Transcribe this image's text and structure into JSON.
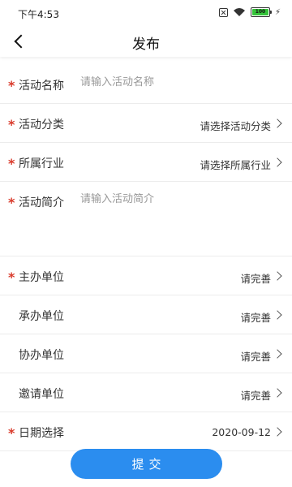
{
  "status_bar": {
    "time": "下午4:53",
    "battery": "100",
    "icons": [
      "sim-x-icon",
      "wifi-icon",
      "battery-icon",
      "charging-icon"
    ]
  },
  "header": {
    "title": "发布",
    "back_icon": "back-arrow-icon"
  },
  "form": {
    "activity_name": {
      "label": "活动名称",
      "placeholder": "请输入活动名称",
      "required": true
    },
    "activity_category": {
      "label": "活动分类",
      "value": "请选择活动分类",
      "required": true
    },
    "industry": {
      "label": "所属行业",
      "value": "请选择所属行业",
      "required": true
    },
    "activity_intro": {
      "label": "活动简介",
      "placeholder": "请输入活动简介",
      "required": true
    },
    "host_unit": {
      "label": "主办单位",
      "value": "请完善",
      "required": true
    },
    "organizer_unit": {
      "label": "承办单位",
      "value": "请完善",
      "required": false
    },
    "co_organizer_unit": {
      "label": "协办单位",
      "value": "请完善",
      "required": false
    },
    "invited_unit": {
      "label": "邀请单位",
      "value": "请完善",
      "required": false
    },
    "date": {
      "label": "日期选择",
      "value": "2020-09-12",
      "required": true
    }
  },
  "required_mark": "*",
  "submit_label": "提交",
  "colors": {
    "accent": "#2b8def",
    "required": "#d93a2b",
    "battery": "#35c33a"
  }
}
